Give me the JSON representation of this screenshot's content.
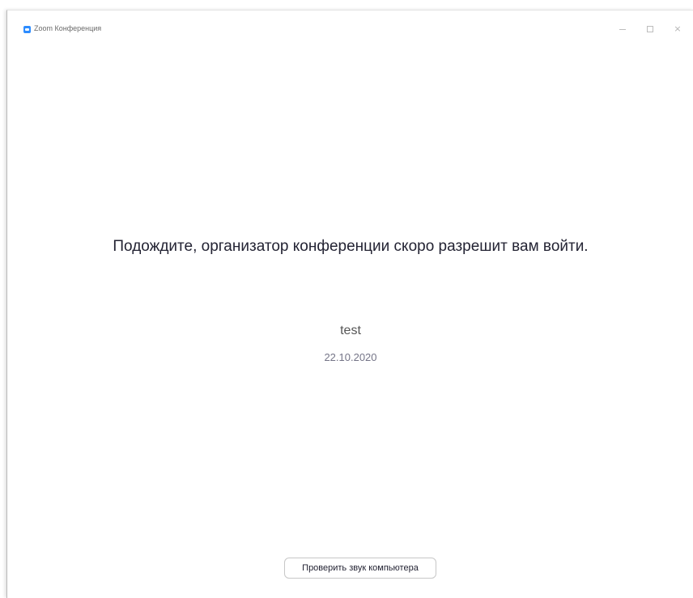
{
  "window": {
    "title": "Zoom Конференция",
    "controls": {
      "minimize_icon": "minimize-icon",
      "maximize_icon": "maximize-icon",
      "close_glyph": "×"
    }
  },
  "main": {
    "waiting_message": "Подождите, организатор конференции скоро разрешит вам войти.",
    "meeting_topic": "test",
    "meeting_date": "22.10.2020"
  },
  "footer": {
    "test_audio_label": "Проверить звук компьютера"
  },
  "colors": {
    "brand": "#2d8cff",
    "text_primary": "#232333",
    "text_secondary": "#747487"
  }
}
